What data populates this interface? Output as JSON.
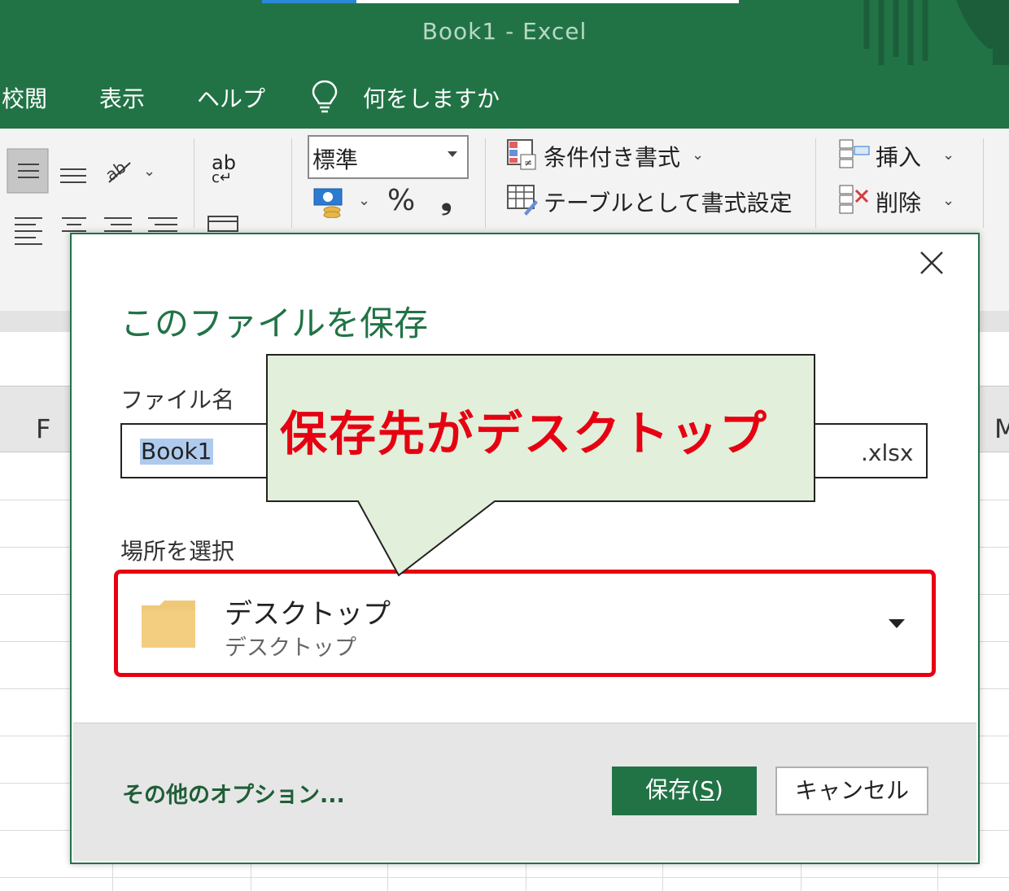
{
  "app": {
    "window_title": "Book1  -  Excel",
    "brand_color": "#217346"
  },
  "menu": {
    "review": "校閲",
    "view": "表示",
    "help": "ヘルプ",
    "tell_me": "何をしますか",
    "tell_me_icon": "lightbulb-icon"
  },
  "ribbon": {
    "number_format": "標準",
    "conditional_format": "条件付き書式",
    "format_as_table": "テーブルとして書式設定",
    "insert": "挿入",
    "delete": "削除",
    "percent": "%",
    "comma": "❟",
    "wrap_text_icon_text": "ab",
    "wrap_text_icon_sub": "c↵"
  },
  "sheet": {
    "column_f": "F",
    "column_m": "M"
  },
  "dialog": {
    "title": "このファイルを保存",
    "filename_label": "ファイル名",
    "filename_value": "Book1",
    "extension": ".xlsx",
    "location_label": "場所を選択",
    "location_primary": "デスクトップ",
    "location_secondary": "デスクトップ",
    "more_options": "その他のオプション...",
    "save_label_prefix": "保存(",
    "save_label_key": "S",
    "save_label_suffix": ")",
    "cancel_label": "キャンセル",
    "highlight_color": "#e60012"
  },
  "callout": {
    "text": "保存先がデスクトップ",
    "text_color": "#e60012",
    "fill_color": "#e2efda"
  }
}
